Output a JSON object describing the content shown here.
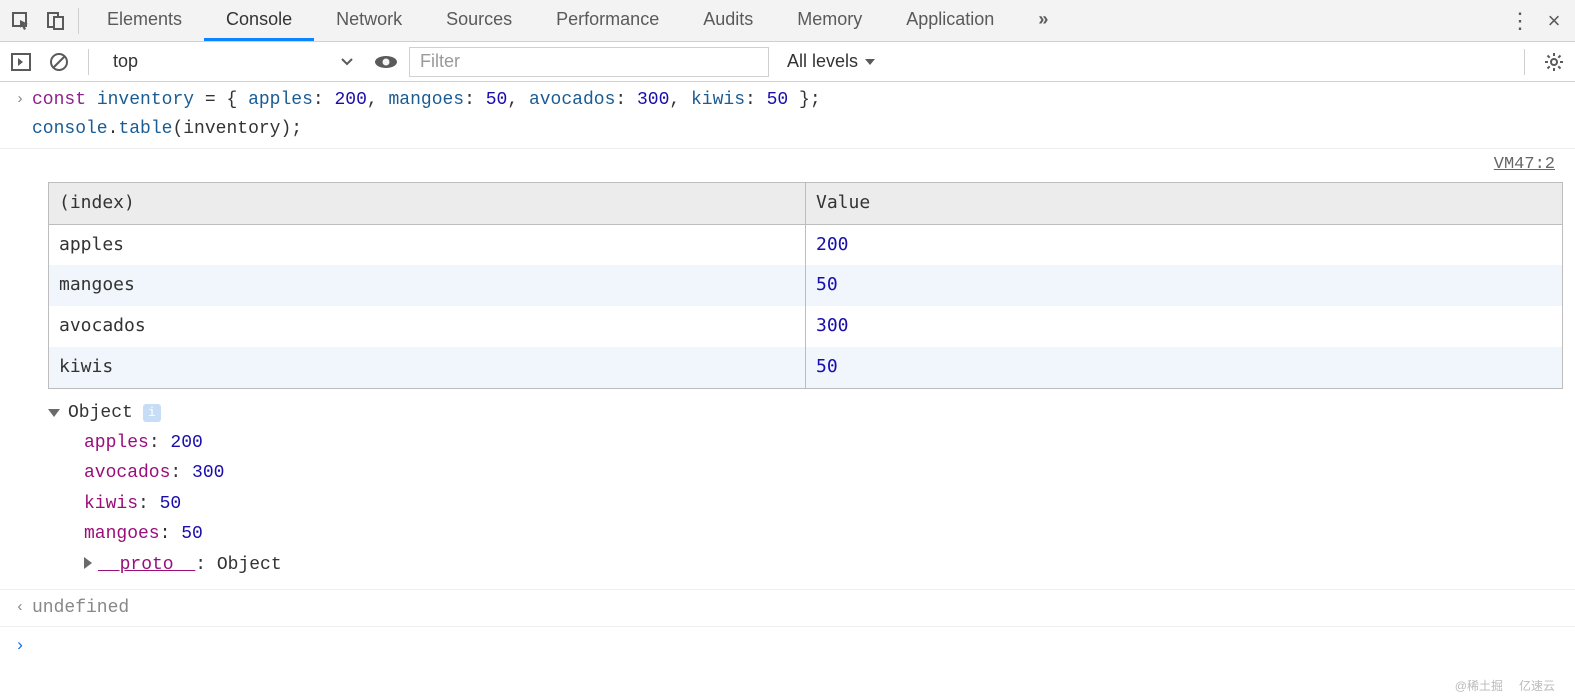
{
  "tabs": {
    "elements": "Elements",
    "console": "Console",
    "network": "Network",
    "sources": "Sources",
    "performance": "Performance",
    "audits": "Audits",
    "memory": "Memory",
    "application": "Application"
  },
  "toolbar": {
    "context": "top",
    "filter_placeholder": "Filter",
    "levels_label": "All levels"
  },
  "input_code": "const inventory = { apples: 200, mangoes: 50, avocados: 300, kiwis: 50 };\nconsole.table(inventory);",
  "code_tokens": {
    "const": "const",
    "space1": " ",
    "inventory": "inventory",
    "assign": " = { ",
    "p1": "apples",
    "c1": ": ",
    "v1": "200",
    "s1": ", ",
    "p2": "mangoes",
    "c2": ": ",
    "v2": "50",
    "s2": ", ",
    "p3": "avocados",
    "c3": ": ",
    "v3": "300",
    "s3": ", ",
    "p4": "kiwis",
    "c4": ": ",
    "v4": "50",
    "end": " };",
    "line2a": "console",
    "line2b": ".",
    "line2c": "table",
    "line2d": "(inventory);"
  },
  "vm": "VM47:2",
  "table": {
    "headers": {
      "index": "(index)",
      "value": "Value"
    },
    "rows": [
      {
        "index": "apples",
        "value": "200"
      },
      {
        "index": "mangoes",
        "value": "50"
      },
      {
        "index": "avocados",
        "value": "300"
      },
      {
        "index": "kiwis",
        "value": "50"
      }
    ]
  },
  "object_dump": {
    "head": "Object",
    "props": [
      {
        "key": "apples",
        "sep": ": ",
        "val": "200"
      },
      {
        "key": "avocados",
        "sep": ": ",
        "val": "300"
      },
      {
        "key": "kiwis",
        "sep": ": ",
        "val": "50"
      },
      {
        "key": "mangoes",
        "sep": ": ",
        "val": "50"
      }
    ],
    "proto_key": "__proto__",
    "proto_sep": ": ",
    "proto_val": "Object"
  },
  "return_value": "undefined",
  "gutters": {
    "in": "›",
    "out": "‹",
    "prompt": "›"
  },
  "watermarks": {
    "w1": "@稀土掘",
    "w2": "亿速云"
  }
}
